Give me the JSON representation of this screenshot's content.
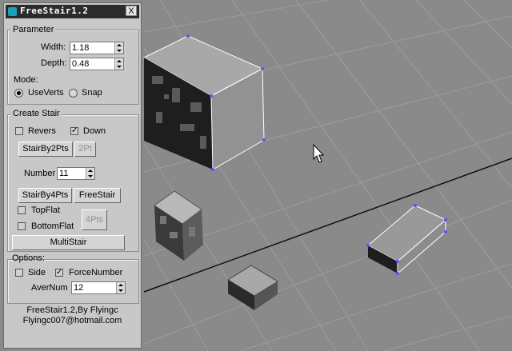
{
  "window": {
    "title": "FreeStair1.2",
    "close_label": "X"
  },
  "parameter": {
    "group_label": "Parameter",
    "width_label": "Width:",
    "width_value": "1.18",
    "depth_label": "Depth:",
    "depth_value": "0.48",
    "mode_label": "Mode:",
    "mode_useverts": "UseVerts",
    "mode_snap": "Snap",
    "mode_selected": "UseVerts"
  },
  "create_stair": {
    "group_label": "Create Stair",
    "revers_label": "Revers",
    "revers_checked": false,
    "down_label": "Down",
    "down_checked": true,
    "stairby2pts_label": "StairBy2Pts",
    "twopt_label": "2Pt",
    "number_label": "Number",
    "number_value": "11",
    "stairby4pts_label": "StairBy4Pts",
    "freestair_label": "FreeStair",
    "topflat_label": "TopFlat",
    "topflat_checked": false,
    "bottomflat_label": "BottomFlat",
    "bottomflat_checked": false,
    "fourpts_label": "4Pts",
    "multistair_label": "MultiStair"
  },
  "options": {
    "group_label": "Options:",
    "side_label": "Side",
    "side_checked": false,
    "forcenumber_label": "ForceNumber",
    "forcenumber_checked": true,
    "avernum_label": "AverNum",
    "avernum_value": "12"
  },
  "footer": {
    "credit": "FreeStair1.2,By Flyingc",
    "email": "Flyingc007@hotmail.com"
  },
  "colors": {
    "viewport_bg": "#8a8a8a",
    "grid_line": "#9c9c9c",
    "selection": "#5555ff",
    "panel_bg": "#c8c8c8"
  }
}
